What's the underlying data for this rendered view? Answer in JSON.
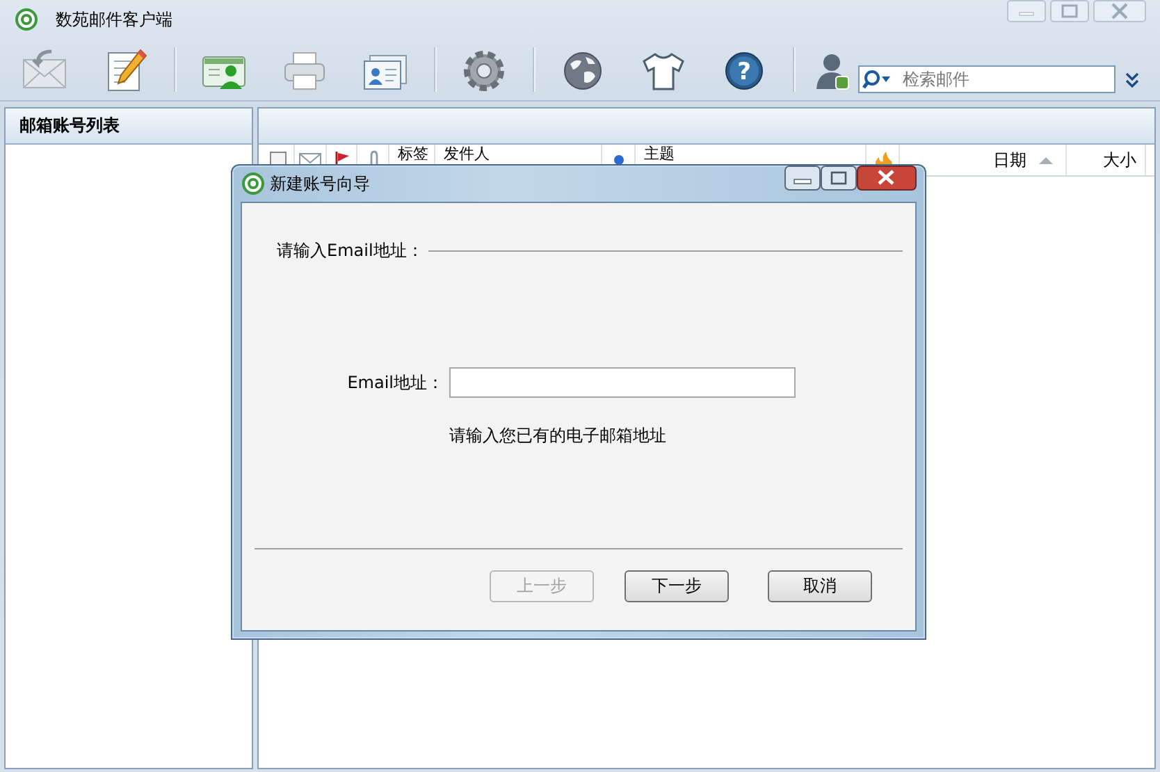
{
  "window": {
    "title": "数苑邮件客户端"
  },
  "toolbar": [
    {
      "kind": "receive"
    },
    {
      "kind": "compose"
    },
    {
      "kind": "separator"
    },
    {
      "kind": "contacts"
    },
    {
      "kind": "print"
    },
    {
      "kind": "cards"
    },
    {
      "kind": "separator"
    },
    {
      "kind": "settings"
    },
    {
      "kind": "separator"
    },
    {
      "kind": "globe"
    },
    {
      "kind": "shirt"
    },
    {
      "kind": "help",
      "glyph": "?"
    },
    {
      "kind": "separator"
    },
    {
      "kind": "user"
    }
  ],
  "search": {
    "placeholder": "检索邮件"
  },
  "sidebar": {
    "title": "邮箱账号列表"
  },
  "table": {
    "columns": [
      {
        "kind": "checkbox"
      },
      {
        "kind": "mail"
      },
      {
        "kind": "flag"
      },
      {
        "kind": "attachment"
      },
      {
        "kind": "text",
        "label": "标签",
        "sorted": false
      },
      {
        "kind": "text",
        "label": "发件人",
        "sorted": false
      },
      {
        "kind": "dot"
      },
      {
        "kind": "text",
        "label": "主题",
        "sorted": false
      },
      {
        "kind": "priority"
      },
      {
        "kind": "text",
        "label": "日期",
        "sorted": true
      },
      {
        "kind": "text",
        "label": "大小",
        "sorted": false
      }
    ]
  },
  "dialog": {
    "title": "新建账号向导",
    "section": "请输入Email地址：",
    "field": {
      "label": "Email地址："
    },
    "hint": "请输入您已有的电子邮箱地址",
    "buttons": [
      {
        "label": "上一步",
        "disabled": true
      },
      {
        "label": "下一步",
        "disabled": false
      },
      {
        "label": "取消",
        "disabled": false
      }
    ]
  }
}
